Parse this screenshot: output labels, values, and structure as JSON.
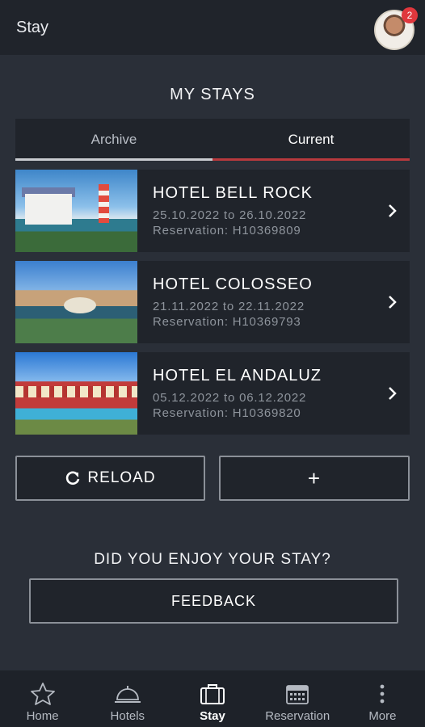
{
  "header": {
    "title": "Stay",
    "badge_count": "2"
  },
  "section_title": "MY STAYS",
  "tabs": [
    {
      "label": "Archive",
      "active": false
    },
    {
      "label": "Current",
      "active": true
    }
  ],
  "stays": [
    {
      "name": "HOTEL BELL ROCK",
      "dates": "25.10.2022 to 26.10.2022",
      "reservation": "Reservation: H10369809"
    },
    {
      "name": "HOTEL COLOSSEO",
      "dates": "21.11.2022 to 22.11.2022",
      "reservation": "Reservation: H10369793"
    },
    {
      "name": "HOTEL EL ANDALUZ",
      "dates": "05.12.2022 to 06.12.2022",
      "reservation": "Reservation: H10369820"
    }
  ],
  "buttons": {
    "reload": "RELOAD",
    "add": "+"
  },
  "feedback": {
    "question": "DID YOU ENJOY YOUR STAY?",
    "button": "FEEDBACK"
  },
  "nav": [
    {
      "label": "Home",
      "icon": "star-icon"
    },
    {
      "label": "Hotels",
      "icon": "service-bell-icon"
    },
    {
      "label": "Stay",
      "icon": "suitcase-icon",
      "active": true
    },
    {
      "label": "Reservation",
      "icon": "calendar-icon"
    },
    {
      "label": "More",
      "icon": "more-vertical-icon"
    }
  ],
  "colors": {
    "background": "#2a2f38",
    "surface": "#20242b",
    "accent": "#b8393d",
    "badge": "#e0373d",
    "muted_text": "#8e949c"
  }
}
